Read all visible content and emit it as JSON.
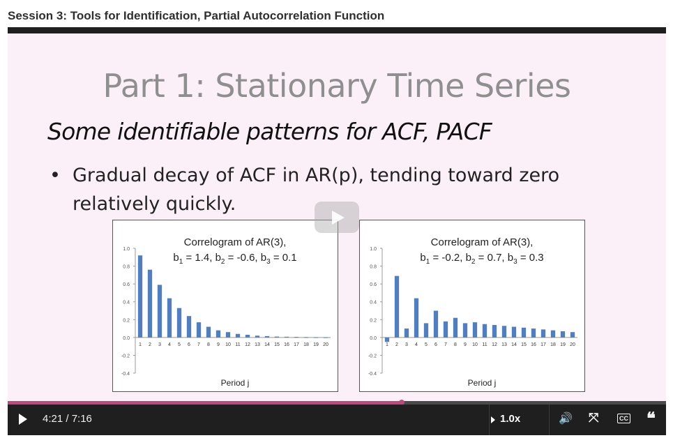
{
  "page": {
    "title": "Session 3: Tools for Identification, Partial Autocorrelation Function"
  },
  "slide": {
    "heading": "Part 1: Stationary Time Series",
    "subheading": "Some identifiable patterns for ACF, PACF",
    "bullet": "Gradual decay of ACF in AR(p), tending toward zero relatively quickly.",
    "bullet_marker": "•"
  },
  "chart_data": [
    {
      "type": "bar",
      "title": "Correlogram of AR(3),",
      "subtitle_parts": [
        {
          "text": "b",
          "sub": "1",
          "val": " = 1.4, "
        },
        {
          "text": "b",
          "sub": "2",
          "val": " = -0.6, "
        },
        {
          "text": "b",
          "sub": "3",
          "val": " = 0.1"
        }
      ],
      "xlabel": "Period j",
      "ylabel": "",
      "ylim": [
        -0.4,
        1.0
      ],
      "yticks": [
        "1.0",
        "0.8",
        "0.6",
        "0.4",
        "0.2",
        "0.0",
        "-0.2",
        "-0.4"
      ],
      "categories": [
        "1",
        "2",
        "3",
        "4",
        "5",
        "6",
        "7",
        "8",
        "9",
        "10",
        "11",
        "12",
        "13",
        "14",
        "15",
        "16",
        "17",
        "18",
        "19",
        "20"
      ],
      "values": [
        0.92,
        0.76,
        0.59,
        0.44,
        0.33,
        0.24,
        0.17,
        0.12,
        0.08,
        0.06,
        0.04,
        0.03,
        0.02,
        0.015,
        0.01,
        0.008,
        0.006,
        0.004,
        0.003,
        0.002
      ],
      "color": "#4f7fc0"
    },
    {
      "type": "bar",
      "title": "Correlogram of AR(3),",
      "subtitle_parts": [
        {
          "text": "b",
          "sub": "1",
          "val": " = -0.2, "
        },
        {
          "text": "b",
          "sub": "2",
          "val": " = 0.7, "
        },
        {
          "text": "b",
          "sub": "3",
          "val": " = 0.3"
        }
      ],
      "xlabel": "Period j",
      "ylabel": "",
      "ylim": [
        -0.4,
        1.0
      ],
      "yticks": [
        "1.0",
        "0.8",
        "0.6",
        "0.4",
        "0.2",
        "0.0",
        "-0.2",
        "-0.4"
      ],
      "categories": [
        "1",
        "2",
        "3",
        "4",
        "5",
        "6",
        "7",
        "8",
        "9",
        "10",
        "11",
        "12",
        "13",
        "14",
        "15",
        "16",
        "17",
        "18",
        "19",
        "20"
      ],
      "values": [
        -0.05,
        0.69,
        0.1,
        0.44,
        0.16,
        0.3,
        0.18,
        0.22,
        0.16,
        0.17,
        0.15,
        0.14,
        0.13,
        0.12,
        0.11,
        0.1,
        0.09,
        0.08,
        0.07,
        0.06
      ],
      "color": "#4f7fc0"
    }
  ],
  "player": {
    "current_time": "4:21",
    "duration": "7:16",
    "time_display": "4:21 / 7:16",
    "progress": 0.598,
    "speed": "1.0x",
    "accent_color": "#c0487f",
    "icons": [
      "play-icon",
      "speed-icon",
      "volume-icon",
      "fullscreen-icon",
      "captions-icon",
      "transcript-icon"
    ],
    "cc_label": "CC",
    "volume_glyph": "🔊",
    "fullscreen_glyph": "⤧",
    "transcript_glyph": "❝"
  }
}
